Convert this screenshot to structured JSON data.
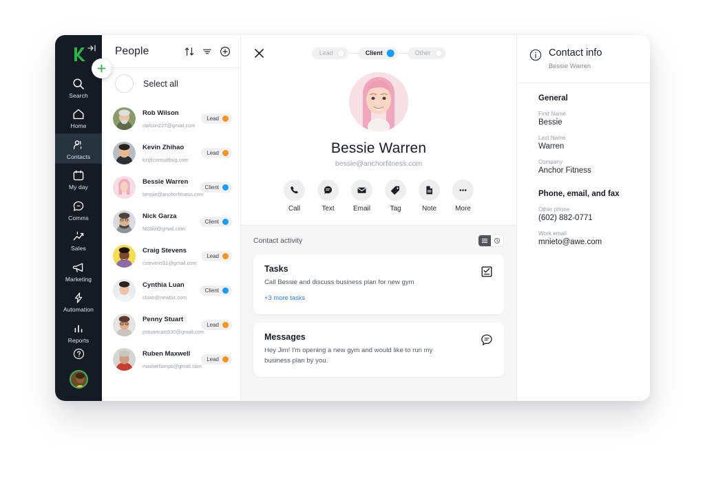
{
  "sidebar": {
    "logo": "keap-logo",
    "collapse_icon": "collapse-panel-icon",
    "items": [
      {
        "label": "Search",
        "icon": "search-icon",
        "active": false
      },
      {
        "label": "Home",
        "icon": "home-icon",
        "active": false
      },
      {
        "label": "Contacts",
        "icon": "contacts-icon",
        "active": true
      },
      {
        "label": "My day",
        "icon": "calendar-icon",
        "active": false
      },
      {
        "label": "Comms",
        "icon": "chat-bubble-icon",
        "active": false
      },
      {
        "label": "Sales",
        "icon": "sales-chart-icon",
        "active": false
      },
      {
        "label": "Marketing",
        "icon": "megaphone-icon",
        "active": false
      },
      {
        "label": "Automation",
        "icon": "lightning-bolt-icon",
        "active": false
      },
      {
        "label": "Reports",
        "icon": "bar-chart-icon",
        "active": false
      }
    ],
    "help_icon": "help-circle-icon",
    "user_avatar": "user-avatar"
  },
  "fab": {
    "icon": "plus-icon",
    "color": "#3fae5a"
  },
  "list_panel": {
    "title": "People",
    "header_icons": [
      "sort-icon",
      "filter-icon",
      "add-contact-icon"
    ],
    "select_all_label": "Select all",
    "contacts": [
      {
        "name": "Rob Wilson",
        "email": "rwilson227@gmail.com",
        "badge": "Lead",
        "badge_color": "#f7941d",
        "avatar_bg": "#8a9a6d",
        "skin": "#e8c3a4",
        "hair": "#dedede"
      },
      {
        "name": "Kevin Zhihao",
        "email": "kz@consultbug.com",
        "badge": "Lead",
        "badge_color": "#f7941d",
        "avatar_bg": "#6e7376",
        "skin": "#e6b98e",
        "hair": "#26221f"
      },
      {
        "name": "Bessie Warren",
        "email": "bessie@anchorfitness.com",
        "badge": "Client",
        "badge_color": "#1a9df5",
        "avatar_bg": "#f6dde4",
        "skin": "#f2cdbb",
        "hair": "#f0a8bd"
      },
      {
        "name": "Nick Garza",
        "email": "NGbiz@gmail.com",
        "badge": "Client",
        "badge_color": "#1a9df5",
        "avatar_bg": "#d8dadd",
        "skin": "#ddb08c",
        "hair": "#4a4340"
      },
      {
        "name": "Craig Stevens",
        "email": "cstevens31@gmail.com",
        "badge": "Lead",
        "badge_color": "#f7941d",
        "avatar_bg": "#f4dd52",
        "skin": "#7b4a2c",
        "hair": "#1d1513"
      },
      {
        "name": "Cynthia Luan",
        "email": "cluan@newbiz.com",
        "badge": "Client",
        "badge_color": "#1a9df5",
        "avatar_bg": "#e9ecef",
        "skin": "#ecc3a6",
        "hair": "#2b2522"
      },
      {
        "name": "Penny Stuart",
        "email": "pstuartcats930@gmail.com",
        "badge": "Lead",
        "badge_color": "#f7941d",
        "avatar_bg": "#e4e4e2",
        "skin": "#e3ad89",
        "hair": "#5c3a2e"
      },
      {
        "name": "Ruben Maxwell",
        "email": "maxwellamps@gmail.com",
        "badge": "Lead",
        "badge_color": "#f7941d",
        "avatar_bg": "#c73f33",
        "skin": "#cda085",
        "hair": "#c9c6c2"
      }
    ]
  },
  "detail_panel": {
    "close_icon": "close-icon",
    "stages": [
      {
        "label": "Lead",
        "active": false
      },
      {
        "label": "Client",
        "active": true
      },
      {
        "label": "Other",
        "active": false
      }
    ],
    "stage_active_color": "#1a9df5",
    "profile": {
      "avatar": "bessie-warren-avatar",
      "name": "Bessie Warren",
      "email": "bessie@anchorfitness.com"
    },
    "actions": [
      {
        "label": "Call",
        "icon": "phone-icon"
      },
      {
        "label": "Text",
        "icon": "message-icon"
      },
      {
        "label": "Email",
        "icon": "envelope-icon"
      },
      {
        "label": "Tag",
        "icon": "tag-icon"
      },
      {
        "label": "Note",
        "icon": "note-icon"
      },
      {
        "label": "More",
        "icon": "ellipsis-icon"
      }
    ],
    "activity": {
      "title": "Contact activity",
      "view_toggle": [
        {
          "icon": "list-view-icon",
          "active": true
        },
        {
          "icon": "clock-view-icon",
          "active": false
        }
      ],
      "cards": [
        {
          "title": "Tasks",
          "body": "Call Bessie and discuss business plan for new gym",
          "link": "+3 more tasks",
          "icon": "task-checklist-icon"
        },
        {
          "title": "Messages",
          "body": "Hey Jim! I'm opening a new gym and would like to run my business plan by you.",
          "link": "",
          "icon": "message-bubble-icon"
        }
      ]
    }
  },
  "info_panel": {
    "icon": "info-circle-icon",
    "title": "Contact info",
    "subtitle": "Bessie Warren",
    "sections": [
      {
        "title": "General",
        "fields": [
          {
            "key": "First Name",
            "value": "Bessie"
          },
          {
            "key": "Last Name",
            "value": "Warren"
          },
          {
            "key": "Company",
            "value": "Anchor Fitness"
          }
        ]
      },
      {
        "title": "Phone, email, and fax",
        "fields": [
          {
            "key": "Other phone",
            "value": "(602) 882-0771"
          },
          {
            "key": "Work email",
            "value": "mnieto@awe.com"
          }
        ]
      }
    ]
  }
}
